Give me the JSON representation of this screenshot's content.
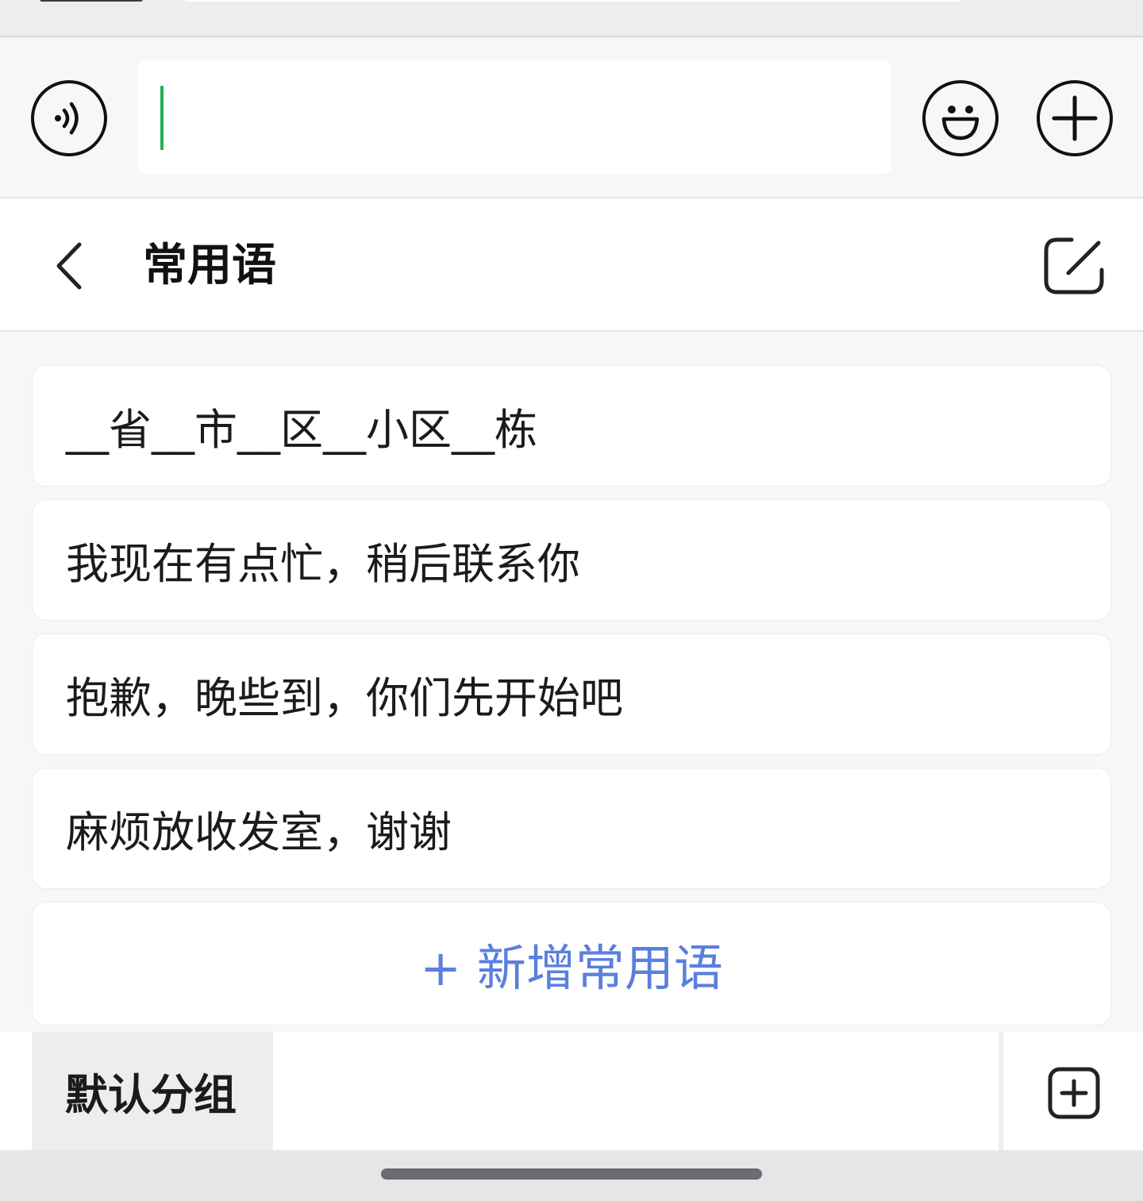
{
  "input_bar": {
    "voice_icon": "voice-mode-icon",
    "emoji_icon": "emoji-icon",
    "more_icon": "plus-icon",
    "input_value": "",
    "caret_color": "#1fb15a"
  },
  "panel": {
    "back_icon": "chevron-left-icon",
    "title": "常用语",
    "edit_icon": "edit-icon"
  },
  "phrases": [
    "__省__市__区__小区__栋",
    "我现在有点忙，稍后联系你",
    "抱歉，晚些到，你们先开始吧",
    "麻烦放收发室，谢谢"
  ],
  "add_phrase_label": "+ 新增常用语",
  "add_phrase_color": "#5b7fde",
  "groups": {
    "active_group": "默认分组",
    "add_group_icon": "add-square-icon"
  }
}
